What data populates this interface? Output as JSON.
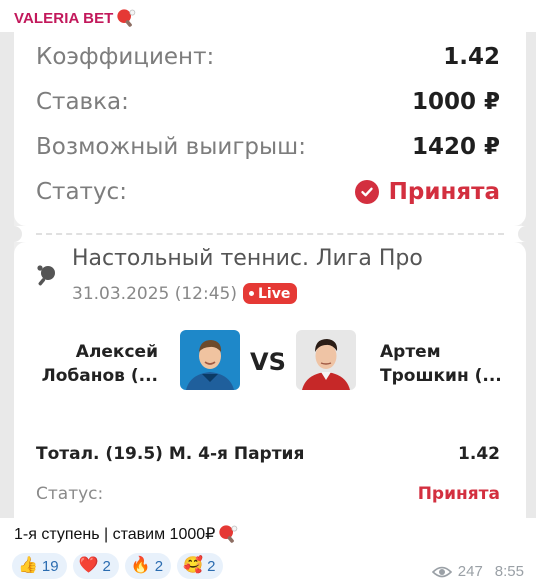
{
  "channel": {
    "name": "VALERIA BET"
  },
  "ticket": {
    "coef_label": "Коэффициент:",
    "coef_value": "1.42",
    "stake_label": "Ставка:",
    "stake_value": "1000 ₽",
    "payout_label": "Возможный выигрыш:",
    "payout_value": "1420 ₽",
    "status_label": "Статус:",
    "status_value": "Принята"
  },
  "event": {
    "league": "Настольный теннис. Лига Про",
    "datetime": "31.03.2025 (12:45)",
    "live_label": "Live",
    "player1": {
      "line1": "Алексей",
      "line2": "Лобанов (..."
    },
    "vs_label": "VS",
    "player2": {
      "line1": "Артем",
      "line2": "Трошкин (..."
    }
  },
  "bet": {
    "market": "Тотал. (19.5) М. 4-я Партия",
    "odds": "1.42",
    "status_label": "Статус:",
    "status_value": "Принята"
  },
  "caption": {
    "text": "1-я ступень | ставим 1000₽"
  },
  "reactions": [
    {
      "emoji": "👍",
      "icon": "thumbs-up-icon",
      "count": "19"
    },
    {
      "emoji": "❤️",
      "icon": "heart-icon",
      "count": "2"
    },
    {
      "emoji": "🔥",
      "icon": "fire-icon",
      "count": "2"
    },
    {
      "emoji": "🥰",
      "icon": "smiling-face-hearts-icon",
      "count": "2"
    }
  ],
  "meta": {
    "views": "247",
    "time": "8:55"
  },
  "colors": {
    "accent_red": "#d32f3f",
    "channel_name": "#c2185b",
    "reaction_bg": "#e8f1fb"
  }
}
